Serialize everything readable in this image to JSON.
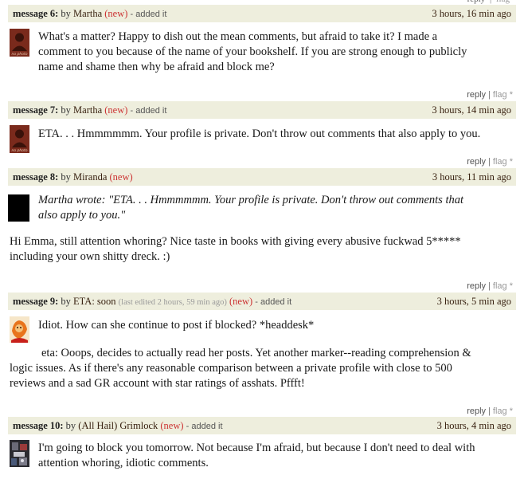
{
  "top_actions": {
    "reply": "reply",
    "flag": "flag"
  },
  "messages": [
    {
      "num": "message 6:",
      "by": "by",
      "author": "Martha",
      "new": "(new)",
      "added": "- added it",
      "time": "3 hours, 16 min ago",
      "avatar_text": "no photo",
      "lines": [
        "What's a matter? Happy to dish out the mean comments, but afraid to take it? I made a",
        "comment to you because of the name of your bookshelf. If you are strong enough to publicly",
        "name and shame then why be afraid and block me?"
      ],
      "reply": "reply",
      "flag": "flag"
    },
    {
      "num": "message 7:",
      "by": "by",
      "author": "Martha",
      "new": "(new)",
      "added": "- added it",
      "time": "3 hours, 14 min ago",
      "avatar_text": "no photo",
      "lines": [
        "ETA. . . Hmmmmmm. Your profile is private. Don't throw out comments that also apply to you."
      ],
      "reply": "reply",
      "flag": "flag"
    },
    {
      "num": "message 8:",
      "by": "by",
      "author": "Miranda",
      "new": "(new)",
      "time": "3 hours, 11 min ago",
      "quote_lines": [
        "Martha wrote: \"ETA. . . Hmmmmmm. Your profile is private. Don't throw out comments that",
        "also apply to you.\""
      ],
      "lines": [
        "Hi Emma, still attention whoring? Nice taste in books with giving every abusive fuckwad 5*****",
        "including your own shitty dreck. :)"
      ],
      "reply": "reply",
      "flag": "flag"
    },
    {
      "num": "message 9:",
      "by": "by",
      "author": "ETA: soon",
      "edited": "(last edited 2 hours, 59 min ago)",
      "new": "(new)",
      "added": "- added it",
      "time": "3 hours, 5 min ago",
      "first_line": "Idiot. How can she continue to post if blocked? *headdesk*",
      "lines": [
        "eta: Ooops, decides to actually read her posts. Yet another marker--reading comprehension &",
        "logic issues. As if there's any reasonable comparison between a private profile with close to 500",
        "reviews and a sad GR account with star ratings of asshats. Pffft!"
      ],
      "reply": "reply",
      "flag": "flag"
    },
    {
      "num": "message 10:",
      "by": "by",
      "author": "(All Hail) Grimlock",
      "new": "(new)",
      "added": "- added it",
      "time": "3 hours, 4 min ago",
      "lines": [
        "I'm going to block you tomorrow. Not because I'm afraid, but because I don't need to deal with",
        "attention whoring, idiotic comments."
      ]
    }
  ]
}
